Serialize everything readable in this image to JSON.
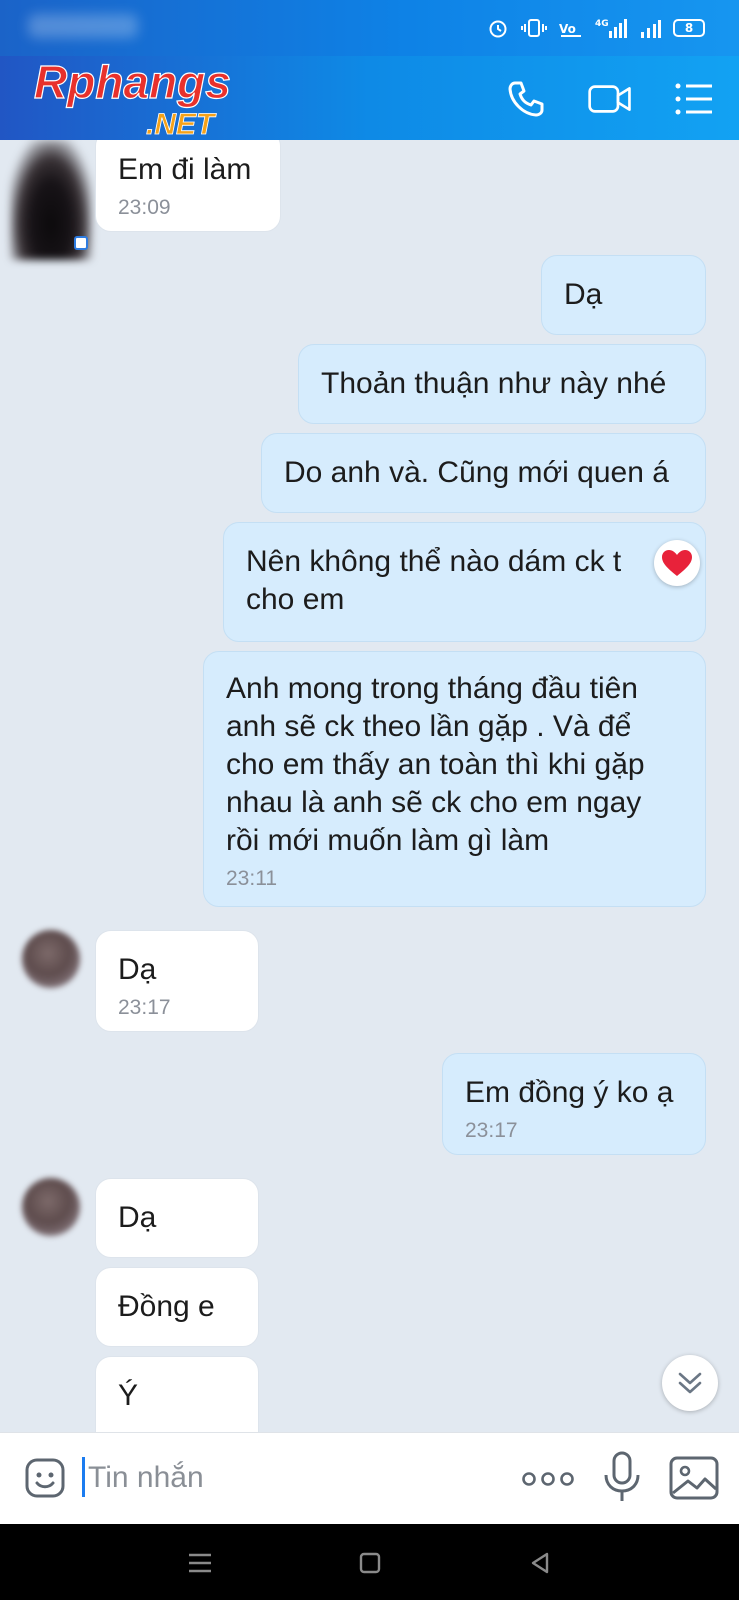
{
  "watermark": {
    "brand": "Rphangs",
    "domain": ".NET"
  },
  "status_bar": {
    "battery": "8"
  },
  "input": {
    "placeholder": "Tin nhắn"
  },
  "messages": [
    {
      "side": "in",
      "text": "Em đi làm",
      "time": "23:09"
    },
    {
      "side": "out",
      "text": "Dạ"
    },
    {
      "side": "out",
      "text": "Thoản thuận như này nhé"
    },
    {
      "side": "out",
      "text": "Do anh và. Cũng mới quen á"
    },
    {
      "side": "out",
      "text": "Nên không thể nào dám ck t\ncho em",
      "reaction": "heart"
    },
    {
      "side": "out",
      "text": "Anh mong trong tháng đầu tiên\nanh sẽ ck theo lần gặp . Và để\ncho em thấy an toàn thì khi gặp\nnhau là anh sẽ ck cho em ngay\nrồi mới muốn làm gì làm",
      "time": "23:11"
    },
    {
      "side": "in",
      "text": "Dạ",
      "time": "23:17"
    },
    {
      "side": "out",
      "text": "Em đồng ý ko ạ",
      "time": "23:17"
    },
    {
      "side": "in",
      "text": "Dạ"
    },
    {
      "side": "in",
      "text": "Đồng e"
    },
    {
      "side": "in",
      "text": "Ý"
    }
  ],
  "colors": {
    "header": "#0e8ae6",
    "bubble_out": "#d6ecfd",
    "bubble_in": "#ffffff",
    "background": "#e2e9f1"
  }
}
